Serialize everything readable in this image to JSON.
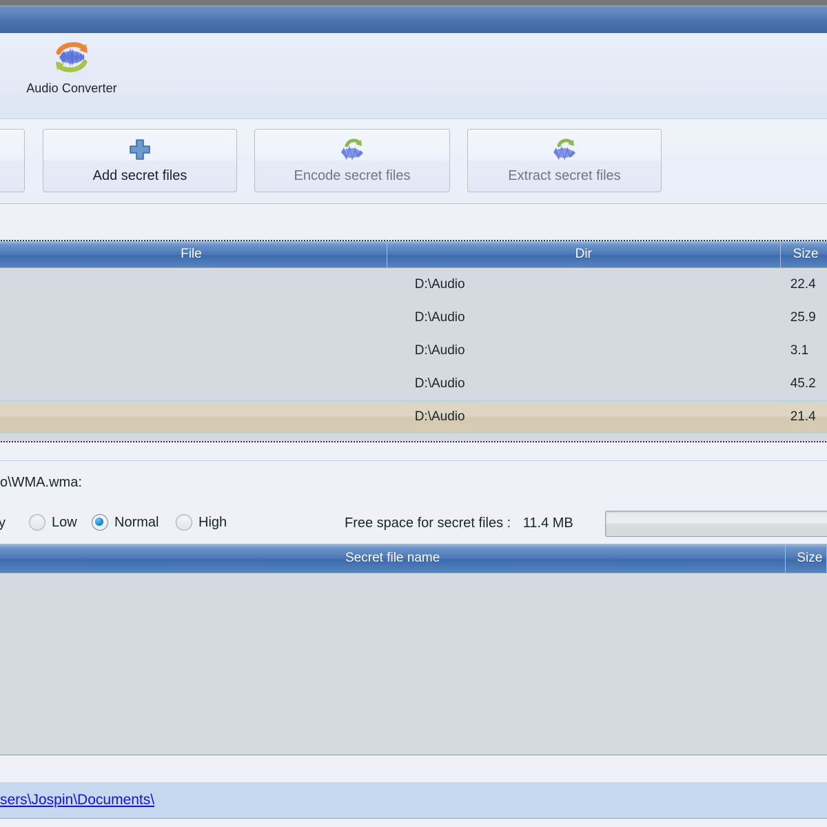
{
  "window": {
    "titlebar_color": "#4a72ae",
    "title": ""
  },
  "brand": {
    "label": "Audio Converter",
    "icon": "audio-converter-icon"
  },
  "toolbar": {
    "buttons": [
      {
        "label": "",
        "icon": "cut-icon",
        "enabled": true,
        "clipped": true
      },
      {
        "label": "Add secret files",
        "icon": "plus-icon",
        "enabled": true
      },
      {
        "label": "Encode secret files",
        "icon": "audio-wave-icon",
        "enabled": false
      },
      {
        "label": "Extract secret files",
        "icon": "audio-wave-icon",
        "enabled": false
      }
    ]
  },
  "carrier_list": {
    "columns": [
      "File",
      "Dir",
      "Size"
    ],
    "rows": [
      {
        "file": "",
        "dir": "D:\\Audio",
        "size": "22.4",
        "selected": false
      },
      {
        "file": "",
        "dir": "D:\\Audio",
        "size": "25.9",
        "selected": false
      },
      {
        "file": "",
        "dir": "D:\\Audio",
        "size": "3.1 ",
        "selected": false
      },
      {
        "file": "",
        "dir": "D:\\Audio",
        "size": "45.2",
        "selected": false
      },
      {
        "file": "",
        "dir": "D:\\Audio",
        "size": "21.4",
        "selected": true
      }
    ]
  },
  "info": {
    "text": "o\\WMA.wma:"
  },
  "options": {
    "quality_label": "y",
    "radios": [
      {
        "label": "Low",
        "selected": false
      },
      {
        "label": "Normal",
        "selected": true
      },
      {
        "label": "High",
        "selected": false
      }
    ],
    "free_space_label": "Free space for secret files :",
    "free_space_value": "11.4 MB",
    "progress_percent": 0
  },
  "secret_list": {
    "columns": [
      "Secret file name",
      "Size"
    ],
    "rows": []
  },
  "status": {
    "link": "sers\\Jospin\\Documents\\"
  },
  "colors": {
    "accent": "#4a72ae",
    "header_blue": "#3d6bae",
    "selection": "#ded5c3",
    "link": "#1414d2",
    "statusbar": "#c6d9f1",
    "list_bg": "#d5dae0"
  }
}
